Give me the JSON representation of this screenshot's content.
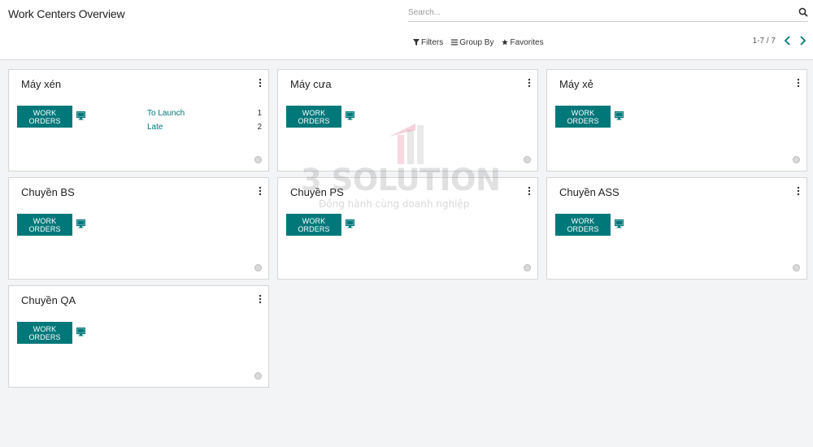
{
  "header": {
    "title": "Work Centers Overview",
    "search_placeholder": "Search...",
    "filters_label": "Filters",
    "group_by_label": "Group By",
    "favorites_label": "Favorites",
    "pager_text": "1-7 / 7"
  },
  "watermark": {
    "brand": "3 SOLUTION",
    "tagline": "Đồng hành cùng doanh nghiệp"
  },
  "cards": [
    {
      "name": "Máy xén",
      "button": "WORK ORDERS",
      "stats": [
        {
          "label": "To Launch",
          "value": "1"
        },
        {
          "label": "Late",
          "value": "2"
        }
      ]
    },
    {
      "name": "Máy cưa",
      "button": "WORK ORDERS",
      "stats": []
    },
    {
      "name": "Máy xẻ",
      "button": "WORK ORDERS",
      "stats": []
    },
    {
      "name": "Chuyền BS",
      "button": "WORK ORDERS",
      "stats": []
    },
    {
      "name": "Chuyền PS",
      "button": "WORK ORDERS",
      "stats": []
    },
    {
      "name": "Chuyền ASS",
      "button": "WORK ORDERS",
      "stats": []
    },
    {
      "name": "Chuyền QA",
      "button": "WORK ORDERS",
      "stats": []
    }
  ],
  "colors": {
    "accent": "#00787a",
    "background": "#f3f4f6"
  }
}
